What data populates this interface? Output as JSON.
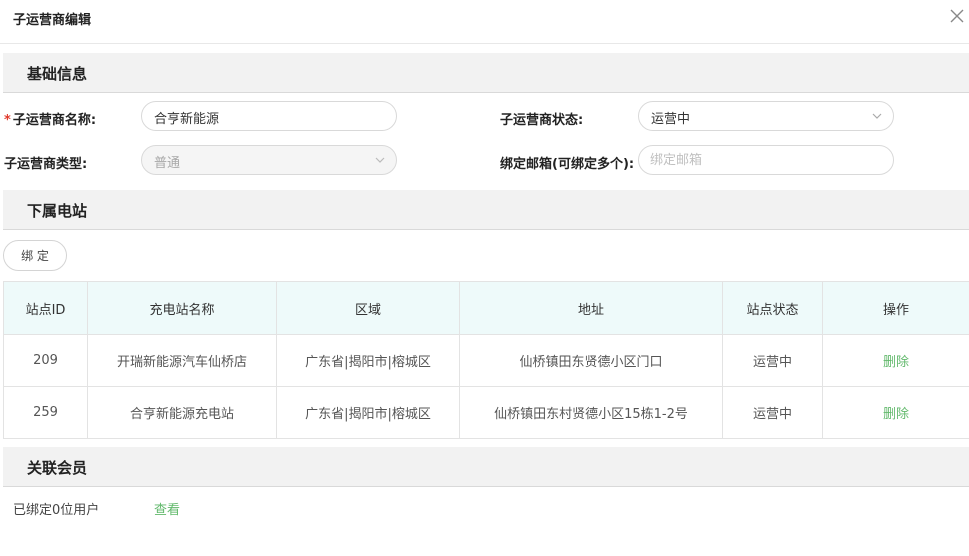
{
  "dialog": {
    "title": "子运营商编辑"
  },
  "sections": {
    "basic": "基础信息",
    "stations": "下属电站",
    "members": "关联会员"
  },
  "form": {
    "name_label": "子运营商名称:",
    "name_value": "合亨新能源",
    "status_label": "子运营商状态:",
    "status_value": "运营中",
    "type_label": "子运营商类型:",
    "type_value": "普通",
    "email_label": "绑定邮箱(可绑定多个):",
    "email_placeholder": "绑定邮箱",
    "required_mark": "*"
  },
  "stations": {
    "bind_label": "绑 定",
    "columns": [
      "站点ID",
      "充电站名称",
      "区域",
      "地址",
      "站点状态",
      "操作"
    ],
    "rows": [
      {
        "id": "209",
        "name": "开瑞新能源汽车仙桥店",
        "region": "广东省|揭阳市|榕城区",
        "address": "仙桥镇田东贤德小区门口",
        "status": "运营中",
        "action": "删除"
      },
      {
        "id": "259",
        "name": "合亨新能源充电站",
        "region": "广东省|揭阳市|榕城区",
        "address": "仙桥镇田东村贤德小区15栋1-2号",
        "status": "运营中",
        "action": "删除"
      }
    ]
  },
  "members": {
    "summary": "已绑定0位用户",
    "view_label": "查看"
  },
  "icons": {
    "close": "close-icon",
    "dropdown": "chevron-down-icon"
  },
  "colors": {
    "accent_green": "#62b96c",
    "required_red": "#e0392b",
    "table_header_bg": "#eefafa"
  }
}
